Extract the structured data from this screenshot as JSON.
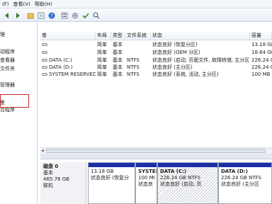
{
  "menu": [
    "(F)",
    "查看(V)",
    "帮助(H)"
  ],
  "toolbar": {
    "icons": [
      "back-icon",
      "forward-icon",
      "up-icon",
      "properties-icon",
      "help-icon",
      "list-view-icon",
      "settings-icon",
      "check-icon",
      "search-icon"
    ]
  },
  "nav": {
    "items": [
      "理",
      "动程序",
      "查看器",
      "文件夹",
      "",
      "管理器",
      "",
      "里",
      "合程序"
    ]
  },
  "list": {
    "columns": [
      "卷",
      "布局",
      "类型",
      "文件系统",
      "状态",
      "容量"
    ],
    "rows": [
      [
        "",
        "简单",
        "基本",
        "",
        "状态良好 (恢复分区)",
        "13.18 GB"
      ],
      [
        "",
        "简单",
        "基本",
        "",
        "状态良好 (OEM 分区)",
        "18.64 GB"
      ],
      [
        "DATA (C:)",
        "简单",
        "基本",
        "NTFS",
        "状态良好 (启动, 页面文件, 故障转储, 主分区)",
        "226.24 GB"
      ],
      [
        "DATA (D:)",
        "简单",
        "基本",
        "NTFS",
        "状态良好 (主分区)",
        "226.24 GB"
      ],
      [
        "SYSTEM RESERVED",
        "简单",
        "基本",
        "NTFS",
        "状态良好 (系统, 活动, 主分区)",
        "100 MB"
      ]
    ]
  },
  "disk": {
    "name": "磁盘 0",
    "type": "基本",
    "size": "465.76 GB",
    "status": "联机",
    "partitions": [
      {
        "name": "",
        "size": "13.18 GB",
        "status": "状态良好 (恢复分",
        "selected": false
      },
      {
        "name": "SYSTEI",
        "size": "100 MI",
        "status": "状态良",
        "selected": false
      },
      {
        "name": "DATA  (C:)",
        "size": "226.24 GB NTFS",
        "status": "状态良好 (启动, 页",
        "selected": true
      },
      {
        "name": "DATA  (D:)",
        "size": "226.24 GB NTFS",
        "status": "状态良好 (主分区",
        "selected": false
      }
    ]
  },
  "colors": {
    "partition_bar": "#1c2fa8",
    "nav_highlight": "#cf2a2a"
  }
}
